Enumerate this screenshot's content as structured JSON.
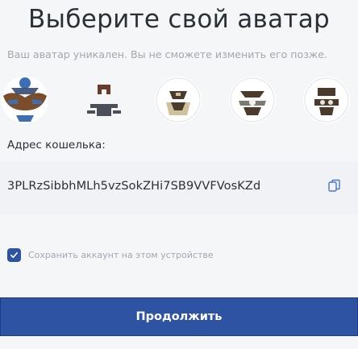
{
  "header": {
    "title": "Выберите свой аватар",
    "subtitle": "Ваш аватар уникален. Вы не сможете изменить его позже."
  },
  "avatars": [
    {
      "name": "avatar-option-1"
    },
    {
      "name": "avatar-option-2"
    },
    {
      "name": "avatar-option-3"
    },
    {
      "name": "avatar-option-4"
    },
    {
      "name": "avatar-option-5"
    }
  ],
  "wallet": {
    "label": "Адрес кошелька:",
    "address": "3PLRzSibbhMLh5vzSokZHi7SB9VVFVosKZd"
  },
  "remember": {
    "checked": true,
    "label": "Сохранить аккаунт на этом устройстве"
  },
  "button": {
    "label": "Продолжить"
  },
  "colors": {
    "accent": "#2f53a3",
    "muted_text": "#a3a7ae",
    "text": "#2b2f36"
  }
}
